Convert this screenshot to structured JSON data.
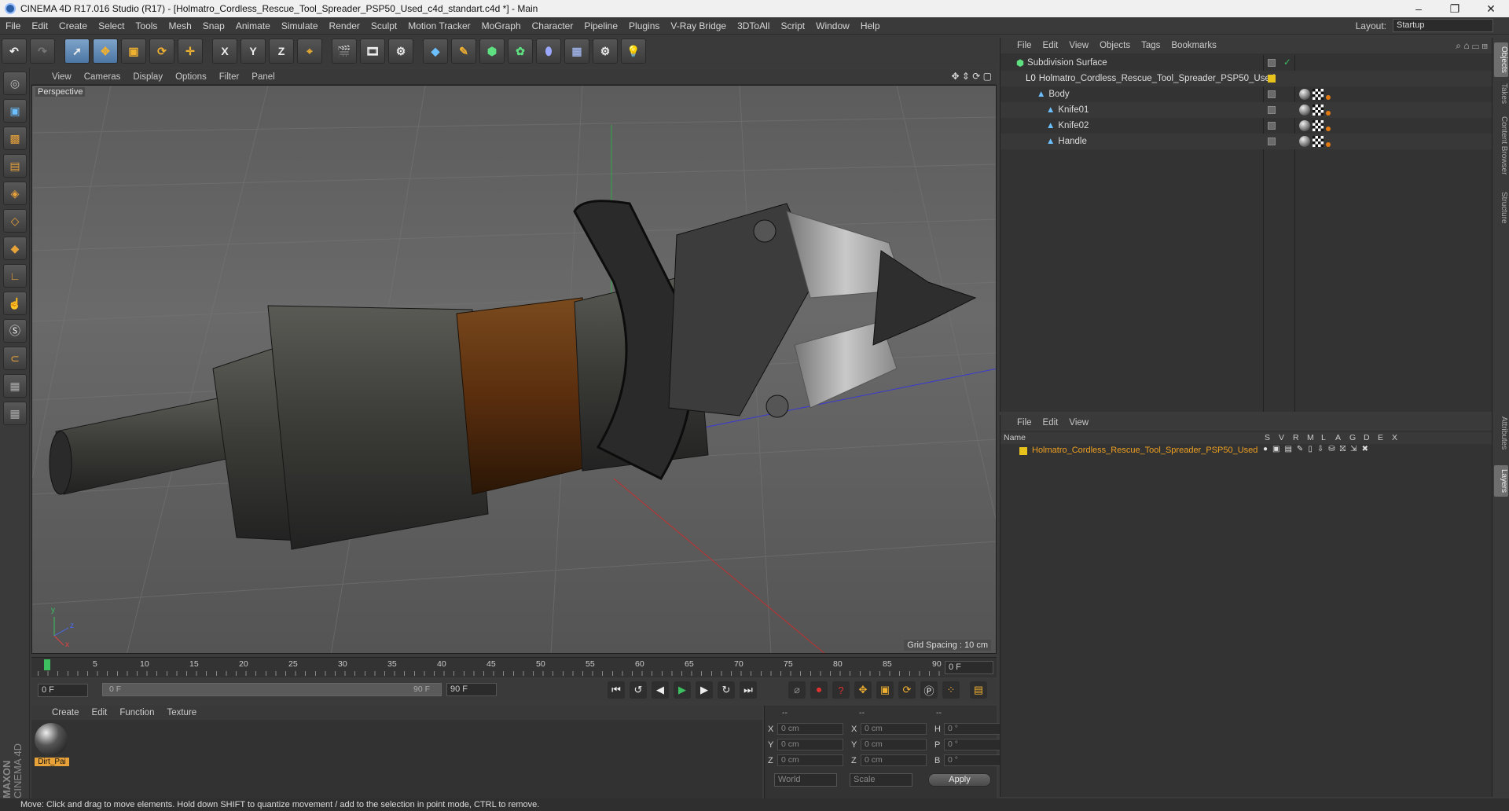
{
  "window": {
    "title": "CINEMA 4D R17.016 Studio (R17) - [Holmatro_Cordless_Rescue_Tool_Spreader_PSP50_Used_c4d_standart.c4d *] - Main",
    "minimize": "–",
    "maximize": "❐",
    "close": "✕"
  },
  "menubar": {
    "items": [
      "File",
      "Edit",
      "Create",
      "Select",
      "Tools",
      "Mesh",
      "Snap",
      "Animate",
      "Simulate",
      "Render",
      "Sculpt",
      "Motion Tracker",
      "MoGraph",
      "Character",
      "Pipeline",
      "Plugins",
      "V-Ray Bridge",
      "3DToAll",
      "Script",
      "Window",
      "Help"
    ],
    "layout_label": "Layout:",
    "layout_value": "Startup"
  },
  "toolbar": {
    "axis_x": "X",
    "axis_y": "Y",
    "axis_z": "Z"
  },
  "viewport": {
    "menu": [
      "View",
      "Cameras",
      "Display",
      "Options",
      "Filter",
      "Panel"
    ],
    "camera_label": "Perspective",
    "grid_spacing": "Grid Spacing : 10 cm",
    "axis_y": "y",
    "axis_z": "z",
    "axis_x": "x"
  },
  "timeline": {
    "ticks": [
      "0",
      "5",
      "10",
      "15",
      "20",
      "25",
      "30",
      "35",
      "40",
      "45",
      "50",
      "55",
      "60",
      "65",
      "70",
      "75",
      "80",
      "85",
      "90"
    ],
    "current_frame": "0 F"
  },
  "transport": {
    "start_field": "0 F",
    "range_start": "0 F",
    "range_end": "90 F",
    "end_field": "90 F"
  },
  "material_panel": {
    "menu": [
      "Create",
      "Edit",
      "Function",
      "Texture"
    ],
    "material_name": "Dirt_Pai"
  },
  "coordinates": {
    "header": [
      "--",
      "--",
      "--"
    ],
    "rows": [
      {
        "a": "X",
        "av": "0 cm",
        "b": "X",
        "bv": "0 cm",
        "c": "H",
        "cv": "0 °"
      },
      {
        "a": "Y",
        "av": "0 cm",
        "b": "Y",
        "bv": "0 cm",
        "c": "P",
        "cv": "0 °"
      },
      {
        "a": "Z",
        "av": "0 cm",
        "b": "Z",
        "bv": "0 cm",
        "c": "B",
        "cv": "0 °"
      }
    ],
    "world": "World",
    "scale": "Scale",
    "apply": "Apply"
  },
  "objects_panel": {
    "menu": [
      "File",
      "Edit",
      "View",
      "Objects",
      "Tags",
      "Bookmarks"
    ],
    "items": [
      {
        "name": "Subdivision Surface",
        "level": 0
      },
      {
        "name": "Holmatro_Cordless_Rescue_Tool_Spreader_PSP50_Used",
        "level": 1
      },
      {
        "name": "Body",
        "level": 2
      },
      {
        "name": "Knife01",
        "level": 3
      },
      {
        "name": "Knife02",
        "level": 3
      },
      {
        "name": "Handle",
        "level": 3
      }
    ]
  },
  "layers_panel": {
    "menu": [
      "File",
      "Edit",
      "View"
    ],
    "col_name": "Name",
    "cols": [
      "S",
      "V",
      "R",
      "M",
      "L",
      "A",
      "G",
      "D",
      "E",
      "X"
    ],
    "layer_name": "Holmatro_Cordless_Rescue_Tool_Spreader_PSP50_Used",
    "layer_color": "#e8c21c"
  },
  "right_tabs": [
    "Objects",
    "Takes",
    "Content Browser",
    "Structure",
    "Attributes",
    "Layers"
  ],
  "status": "Move: Click and drag to move elements. Hold down SHIFT to quantize movement / add to the selection in point mode, CTRL to remove.",
  "brand": {
    "line1": "MAXON",
    "line2": "CINEMA 4D"
  },
  "colors": {
    "accent": "#e8a23a",
    "selection_blue": "#4c76a3",
    "layer_text": "#f0a020"
  }
}
